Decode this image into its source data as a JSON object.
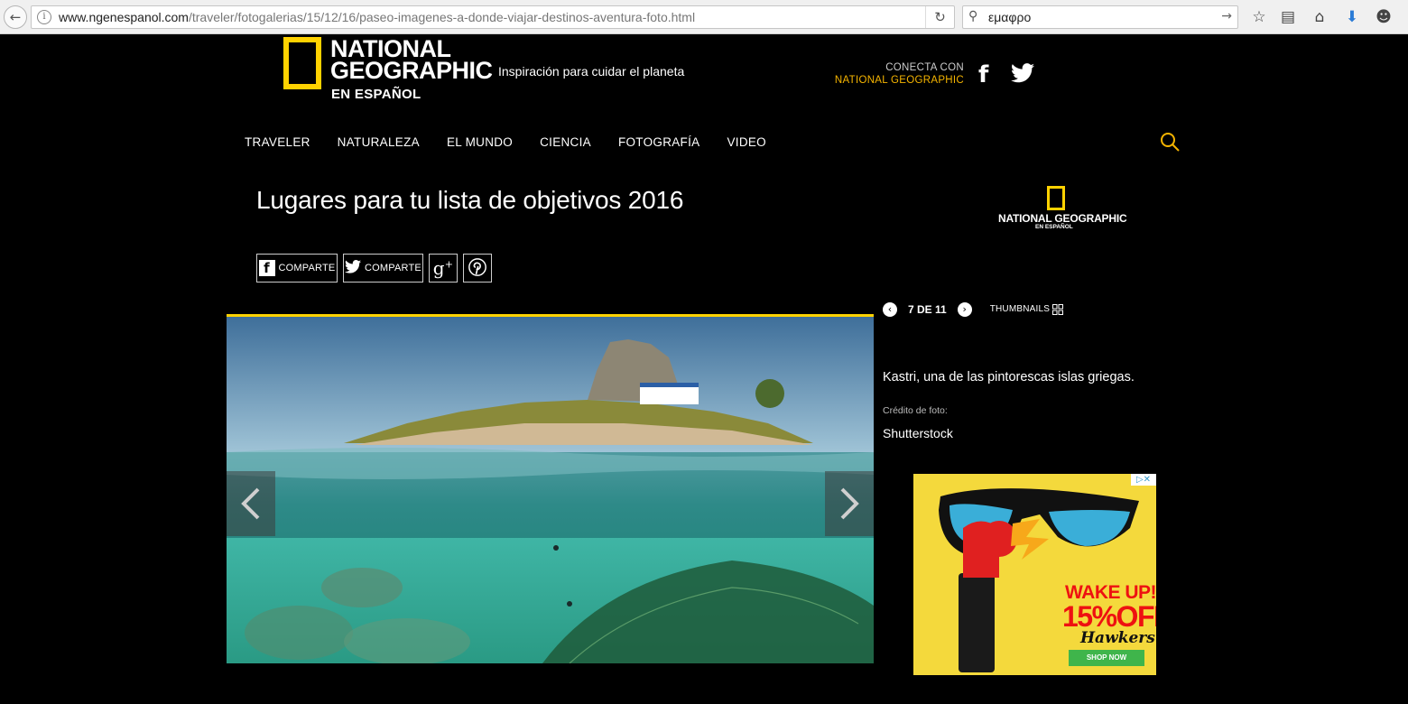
{
  "browser": {
    "url_host": "www.ngenespanol.com",
    "url_path": "/traveler/fotogalerias/15/12/16/paseo-imagenes-a-donde-viajar-destinos-aventura-foto.html",
    "search_query": "εμαφρο"
  },
  "header": {
    "logo_line1": "NATIONAL",
    "logo_line2": "GEOGRAPHIC",
    "logo_sub": "EN ESPAÑOL",
    "tagline": "Inspiración para cuidar el planeta",
    "connect_line1": "CONECTA CON",
    "connect_line2": "NATIONAL GEOGRAPHIC"
  },
  "nav": [
    "TRAVELER",
    "NATURALEZA",
    "EL MUNDO",
    "CIENCIA",
    "FOTOGRAFÍA",
    "VIDEO"
  ],
  "article": {
    "title": "Lugares para tu lista de objetivos 2016",
    "share_facebook": "COMPARTE",
    "share_twitter": "COMPARTE"
  },
  "side_logo": {
    "text": "NATIONAL GEOGRAPHIC",
    "sub": "EN ESPAÑOL"
  },
  "gallery": {
    "position": "7 DE 11",
    "thumbnails_label": "THUMBNAILS",
    "caption": "Kastri, una de las pintorescas islas griegas.",
    "credit_label": "Crédito de foto:",
    "credit": "Shutterstock"
  },
  "ad": {
    "headline": "WAKE UP!",
    "offer": "15%OFF",
    "brand": "Hawkers",
    "cta": "SHOP NOW"
  },
  "colors": {
    "brand_yellow": "#ffd200",
    "connect_accent": "#f5b400"
  },
  "icons": [
    "back-icon",
    "info-icon",
    "reload-icon",
    "search-icon",
    "go-icon",
    "bookmark-star-icon",
    "reading-list-icon",
    "home-icon",
    "download-icon",
    "smiley-icon",
    "facebook-icon",
    "twitter-icon",
    "googleplus-icon",
    "pinterest-icon",
    "chevron-left-icon",
    "chevron-right-icon",
    "grid-icon"
  ]
}
